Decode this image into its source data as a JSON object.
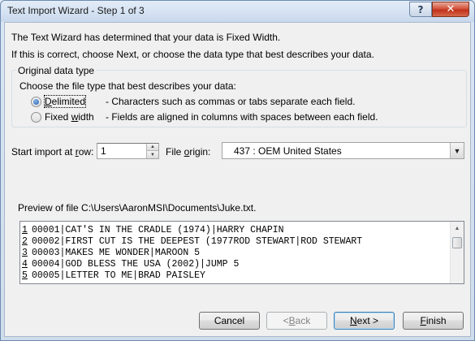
{
  "window": {
    "title": "Text Import Wizard - Step 1 of 3",
    "help_glyph": "?",
    "close_glyph": "✕"
  },
  "info": {
    "line1": "The Text Wizard has determined that your data is Fixed Width.",
    "line2": "If this is correct, choose Next, or choose the data type that best describes your data."
  },
  "data_type": {
    "legend": "Original data type",
    "prompt": "Choose the file type that best describes your data:",
    "options": [
      {
        "label_mnemonic": "D",
        "label_rest": "elimited",
        "description": "- Characters such as commas or tabs separate each field.",
        "selected": true
      },
      {
        "label_pre": "Fixed ",
        "label_mnemonic": "w",
        "label_rest": "idth",
        "description": "- Fields are aligned in columns with spaces between each field.",
        "selected": false
      }
    ]
  },
  "start_row": {
    "label_pre": "Start import at ",
    "label_mnemonic": "r",
    "label_rest": "ow:",
    "value": "1"
  },
  "file_origin": {
    "label_pre": "File ",
    "label_mnemonic": "o",
    "label_rest": "rigin:",
    "value": "437 : OEM United States"
  },
  "preview": {
    "label": "Preview of file C:\\Users\\AaronMSI\\Documents\\Juke.txt.",
    "lines": [
      {
        "num": "1",
        "text": "00001|CAT'S IN THE CRADLE (1974)|HARRY CHAPIN"
      },
      {
        "num": "2",
        "text": "00002|FIRST CUT IS THE DEEPEST (1977ROD STEWART|ROD STEWART"
      },
      {
        "num": "3",
        "text": "00003|MAKES ME WONDER|MAROON 5"
      },
      {
        "num": "4",
        "text": "00004|GOD BLESS THE USA (2002)|JUMP 5"
      },
      {
        "num": "5",
        "text": "00005|LETTER TO ME|BRAD PAISLEY"
      }
    ]
  },
  "buttons": {
    "cancel": "Cancel",
    "back_pre": "< ",
    "back_mnemonic": "B",
    "back_rest": "ack",
    "next_mnemonic": "N",
    "next_rest": "ext >",
    "finish_mnemonic": "F",
    "finish_rest": "inish"
  },
  "icons": {
    "help": "help-icon",
    "close": "close-icon",
    "spin_up": "spin-up-arrow-icon",
    "spin_down": "spin-down-arrow-icon",
    "combo": "chevron-down-icon",
    "scroll_up": "scroll-up-arrow-icon"
  }
}
